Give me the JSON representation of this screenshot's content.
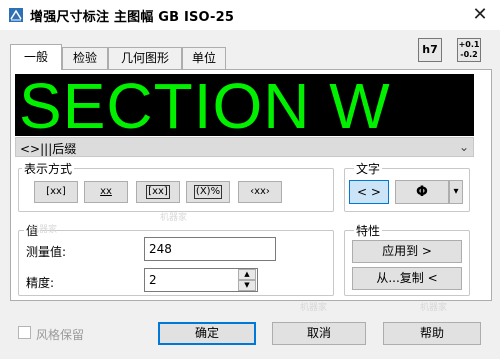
{
  "window": {
    "title": "增强尺寸标注 主图幅 GB ISO-25",
    "close_icon": "close-icon"
  },
  "tabs": [
    {
      "label": "一般",
      "active": true
    },
    {
      "label": "检验",
      "active": false
    },
    {
      "label": "几何图形",
      "active": false
    },
    {
      "label": "单位",
      "active": false
    }
  ],
  "top_buttons": {
    "h7": "h7",
    "tolerance_top": "+0.1",
    "tolerance_bottom": "-0.2"
  },
  "preview": {
    "text": "SECTION W",
    "color": "#00f000"
  },
  "combo": {
    "value": "<>|||后缀"
  },
  "display_group": {
    "label": "表示方式",
    "buttons": [
      "[xx]",
      "xx",
      "[xx]",
      "(X)%",
      "‹xx›"
    ]
  },
  "text_group": {
    "label": "文字",
    "angle_btn": "< >",
    "symbol_btn": "Φ",
    "dropdown": "▾"
  },
  "value_group": {
    "label": "值",
    "measured_label": "测量值:",
    "measured_value": "248",
    "precision_label": "精度:",
    "precision_value": "2"
  },
  "props_group": {
    "label": "特性",
    "apply_to": "应用到 >",
    "copy_from": "从...复制 <"
  },
  "bottom": {
    "style_keep": "风格保留",
    "ok": "确定",
    "cancel": "取消",
    "help": "帮助"
  },
  "watermark": "机器家"
}
